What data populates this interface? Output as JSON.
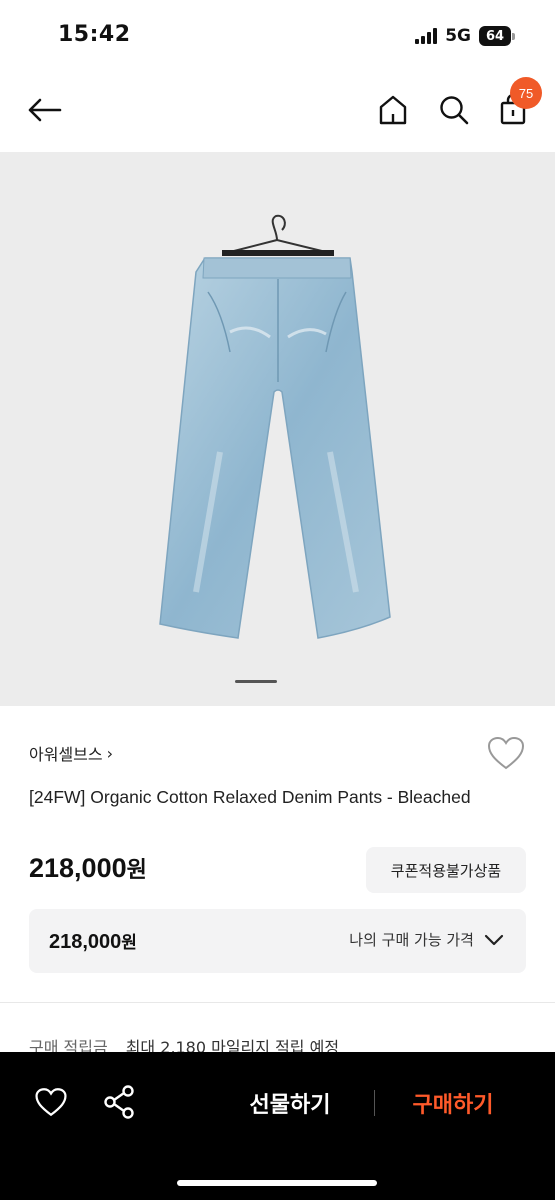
{
  "status_bar": {
    "time": "15:42",
    "network": "5G",
    "battery": "64"
  },
  "nav": {
    "cart_count": "75"
  },
  "product": {
    "brand": "아워셀브스",
    "brand_chevron": "›",
    "title": "[24FW] Organic Cotton Relaxed Denim Pants - Bleached",
    "price_number": "218,000",
    "price_unit": "원",
    "coupon_label": "쿠폰적용불가상품",
    "my_price_number": "218,000",
    "my_price_unit": "원",
    "my_price_label": "나의 구매 가능 가격",
    "points_label": "구매 적립금",
    "points_value": "최대 2,180 마일리지 적립 예정"
  },
  "bottom_bar": {
    "gift_label": "선물하기",
    "buy_label": "구매하기"
  },
  "colors": {
    "accent": "#f05a28",
    "buy": "#ff5a2a",
    "image_bg": "#ececec",
    "box_bg": "#f3f3f4"
  },
  "icons": [
    "back-arrow-icon",
    "home-icon",
    "search-icon",
    "shopping-bag-icon",
    "heart-outline-icon",
    "chevron-down-icon",
    "share-icon"
  ]
}
